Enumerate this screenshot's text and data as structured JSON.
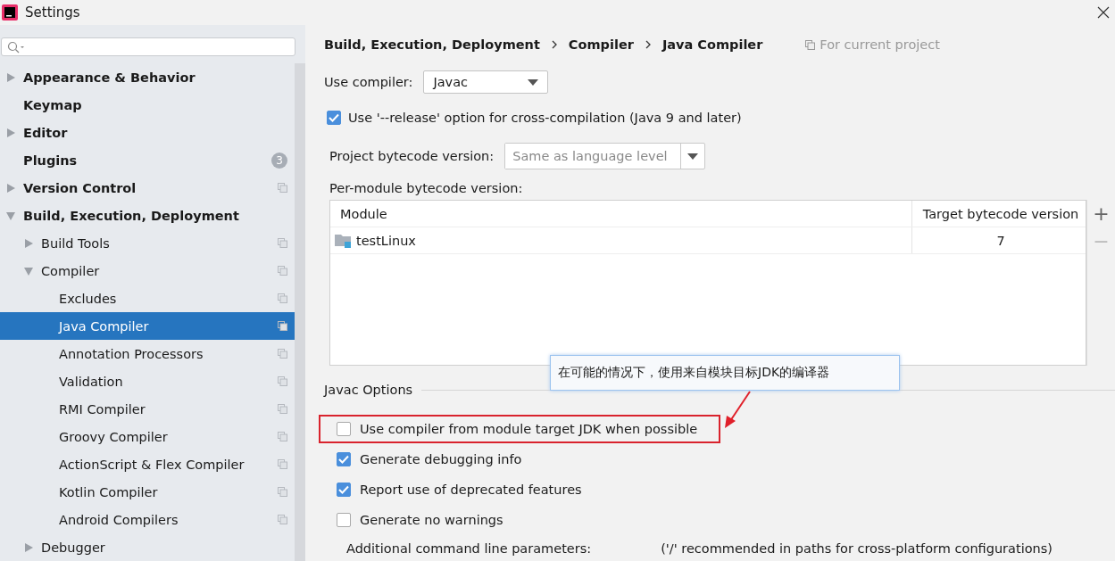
{
  "window": {
    "title": "Settings"
  },
  "sidebar": {
    "items": [
      {
        "label": "Appearance & Behavior",
        "expanded": false,
        "selected": false
      },
      {
        "label": "Keymap",
        "selected": false
      },
      {
        "label": "Editor",
        "expanded": false,
        "selected": false
      },
      {
        "label": "Plugins",
        "selected": false,
        "badge": "3"
      },
      {
        "label": "Version Control",
        "expanded": false,
        "selected": false,
        "project": true
      },
      {
        "label": "Build, Execution, Deployment",
        "expanded": true,
        "selected": false,
        "children": [
          {
            "label": "Build Tools",
            "expanded": false,
            "selected": false,
            "project": true
          },
          {
            "label": "Compiler",
            "expanded": true,
            "selected": false,
            "project": true,
            "children": [
              {
                "label": "Excludes",
                "selected": false,
                "project": true
              },
              {
                "label": "Java Compiler",
                "selected": true,
                "project": true
              },
              {
                "label": "Annotation Processors",
                "selected": false,
                "project": true
              },
              {
                "label": "Validation",
                "selected": false,
                "project": true
              },
              {
                "label": "RMI Compiler",
                "selected": false,
                "project": true
              },
              {
                "label": "Groovy Compiler",
                "selected": false,
                "project": true
              },
              {
                "label": "ActionScript & Flex Compiler",
                "selected": false,
                "project": true
              },
              {
                "label": "Kotlin Compiler",
                "selected": false,
                "project": true
              },
              {
                "label": "Android Compilers",
                "selected": false,
                "project": true
              }
            ]
          },
          {
            "label": "Debugger",
            "expanded": false,
            "selected": false
          }
        ]
      }
    ]
  },
  "breadcrumb": {
    "items": [
      "Build, Execution, Deployment",
      "Compiler",
      "Java Compiler"
    ],
    "scope": "For current project"
  },
  "use_compiler": {
    "label": "Use compiler:",
    "value": "Javac"
  },
  "release_option": {
    "label": "Use '--release' option for cross-compilation (Java 9 and later)",
    "checked": true
  },
  "project_bytecode": {
    "label": "Project bytecode version:",
    "placeholder": "Same as language level"
  },
  "per_module": {
    "label": "Per-module bytecode version:",
    "columns": [
      "Module",
      "Target bytecode version"
    ],
    "rows": [
      {
        "module": "testLinux",
        "version": "7"
      }
    ],
    "add": "+",
    "remove": "−"
  },
  "javac_options": {
    "title": "Javac Options",
    "options": [
      {
        "label": "Use compiler from module target JDK when possible",
        "checked": false,
        "highlighted": true
      },
      {
        "label": "Generate debugging info",
        "checked": true,
        "highlighted": false
      },
      {
        "label": "Report use of deprecated features",
        "checked": true,
        "highlighted": false
      },
      {
        "label": "Generate no warnings",
        "checked": false,
        "highlighted": false
      }
    ],
    "additional_label": "Additional command line parameters:",
    "additional_hint": "('/' recommended in paths for cross-platform configurations)"
  },
  "tooltip": {
    "text": "在可能的情况下，使用来自模块目标JDK的编译器"
  }
}
